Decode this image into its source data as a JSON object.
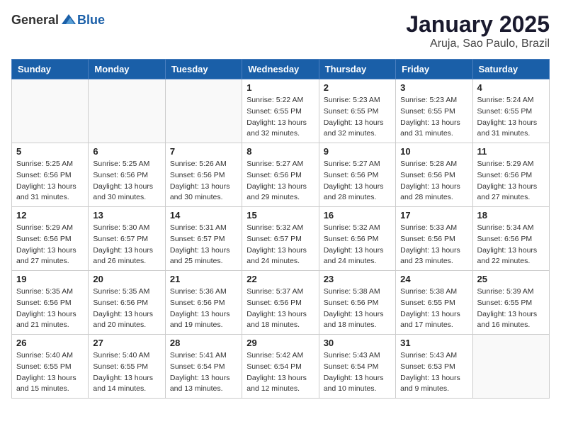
{
  "header": {
    "logo_general": "General",
    "logo_blue": "Blue",
    "month": "January 2025",
    "location": "Aruja, Sao Paulo, Brazil"
  },
  "days_of_week": [
    "Sunday",
    "Monday",
    "Tuesday",
    "Wednesday",
    "Thursday",
    "Friday",
    "Saturday"
  ],
  "weeks": [
    [
      {
        "day": "",
        "info": ""
      },
      {
        "day": "",
        "info": ""
      },
      {
        "day": "",
        "info": ""
      },
      {
        "day": "1",
        "info": "Sunrise: 5:22 AM\nSunset: 6:55 PM\nDaylight: 13 hours\nand 32 minutes."
      },
      {
        "day": "2",
        "info": "Sunrise: 5:23 AM\nSunset: 6:55 PM\nDaylight: 13 hours\nand 32 minutes."
      },
      {
        "day": "3",
        "info": "Sunrise: 5:23 AM\nSunset: 6:55 PM\nDaylight: 13 hours\nand 31 minutes."
      },
      {
        "day": "4",
        "info": "Sunrise: 5:24 AM\nSunset: 6:55 PM\nDaylight: 13 hours\nand 31 minutes."
      }
    ],
    [
      {
        "day": "5",
        "info": "Sunrise: 5:25 AM\nSunset: 6:56 PM\nDaylight: 13 hours\nand 31 minutes."
      },
      {
        "day": "6",
        "info": "Sunrise: 5:25 AM\nSunset: 6:56 PM\nDaylight: 13 hours\nand 30 minutes."
      },
      {
        "day": "7",
        "info": "Sunrise: 5:26 AM\nSunset: 6:56 PM\nDaylight: 13 hours\nand 30 minutes."
      },
      {
        "day": "8",
        "info": "Sunrise: 5:27 AM\nSunset: 6:56 PM\nDaylight: 13 hours\nand 29 minutes."
      },
      {
        "day": "9",
        "info": "Sunrise: 5:27 AM\nSunset: 6:56 PM\nDaylight: 13 hours\nand 28 minutes."
      },
      {
        "day": "10",
        "info": "Sunrise: 5:28 AM\nSunset: 6:56 PM\nDaylight: 13 hours\nand 28 minutes."
      },
      {
        "day": "11",
        "info": "Sunrise: 5:29 AM\nSunset: 6:56 PM\nDaylight: 13 hours\nand 27 minutes."
      }
    ],
    [
      {
        "day": "12",
        "info": "Sunrise: 5:29 AM\nSunset: 6:56 PM\nDaylight: 13 hours\nand 27 minutes."
      },
      {
        "day": "13",
        "info": "Sunrise: 5:30 AM\nSunset: 6:57 PM\nDaylight: 13 hours\nand 26 minutes."
      },
      {
        "day": "14",
        "info": "Sunrise: 5:31 AM\nSunset: 6:57 PM\nDaylight: 13 hours\nand 25 minutes."
      },
      {
        "day": "15",
        "info": "Sunrise: 5:32 AM\nSunset: 6:57 PM\nDaylight: 13 hours\nand 24 minutes."
      },
      {
        "day": "16",
        "info": "Sunrise: 5:32 AM\nSunset: 6:56 PM\nDaylight: 13 hours\nand 24 minutes."
      },
      {
        "day": "17",
        "info": "Sunrise: 5:33 AM\nSunset: 6:56 PM\nDaylight: 13 hours\nand 23 minutes."
      },
      {
        "day": "18",
        "info": "Sunrise: 5:34 AM\nSunset: 6:56 PM\nDaylight: 13 hours\nand 22 minutes."
      }
    ],
    [
      {
        "day": "19",
        "info": "Sunrise: 5:35 AM\nSunset: 6:56 PM\nDaylight: 13 hours\nand 21 minutes."
      },
      {
        "day": "20",
        "info": "Sunrise: 5:35 AM\nSunset: 6:56 PM\nDaylight: 13 hours\nand 20 minutes."
      },
      {
        "day": "21",
        "info": "Sunrise: 5:36 AM\nSunset: 6:56 PM\nDaylight: 13 hours\nand 19 minutes."
      },
      {
        "day": "22",
        "info": "Sunrise: 5:37 AM\nSunset: 6:56 PM\nDaylight: 13 hours\nand 18 minutes."
      },
      {
        "day": "23",
        "info": "Sunrise: 5:38 AM\nSunset: 6:56 PM\nDaylight: 13 hours\nand 18 minutes."
      },
      {
        "day": "24",
        "info": "Sunrise: 5:38 AM\nSunset: 6:55 PM\nDaylight: 13 hours\nand 17 minutes."
      },
      {
        "day": "25",
        "info": "Sunrise: 5:39 AM\nSunset: 6:55 PM\nDaylight: 13 hours\nand 16 minutes."
      }
    ],
    [
      {
        "day": "26",
        "info": "Sunrise: 5:40 AM\nSunset: 6:55 PM\nDaylight: 13 hours\nand 15 minutes."
      },
      {
        "day": "27",
        "info": "Sunrise: 5:40 AM\nSunset: 6:55 PM\nDaylight: 13 hours\nand 14 minutes."
      },
      {
        "day": "28",
        "info": "Sunrise: 5:41 AM\nSunset: 6:54 PM\nDaylight: 13 hours\nand 13 minutes."
      },
      {
        "day": "29",
        "info": "Sunrise: 5:42 AM\nSunset: 6:54 PM\nDaylight: 13 hours\nand 12 minutes."
      },
      {
        "day": "30",
        "info": "Sunrise: 5:43 AM\nSunset: 6:54 PM\nDaylight: 13 hours\nand 10 minutes."
      },
      {
        "day": "31",
        "info": "Sunrise: 5:43 AM\nSunset: 6:53 PM\nDaylight: 13 hours\nand 9 minutes."
      },
      {
        "day": "",
        "info": ""
      }
    ]
  ]
}
